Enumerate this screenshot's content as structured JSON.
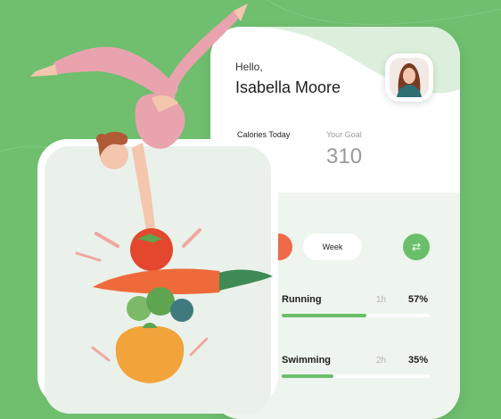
{
  "greeting": "Hello,",
  "user": {
    "name": "Isabella Moore"
  },
  "stats": {
    "calories_label": "Calories Today",
    "goal_label": "Your Goal",
    "goal_value": "310"
  },
  "controls": {
    "week_label": "Week",
    "swap_icon": "swap-icon"
  },
  "activities": [
    {
      "name": "Running",
      "duration": "1h",
      "percent": "57%",
      "progress": 0.57
    },
    {
      "name": "Swimming",
      "duration": "2h",
      "percent": "35%",
      "progress": 0.35
    }
  ],
  "colors": {
    "background": "#6fbf6f",
    "accent_green": "#6bbf6b",
    "accent_orange": "#ef6a4a"
  }
}
